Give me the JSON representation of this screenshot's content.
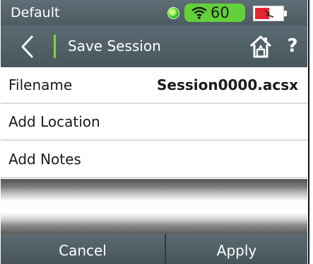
{
  "status_bar": {
    "profile_name": "Default",
    "indicator_color": "#39c51e",
    "wifi_icon": "wifi-icon",
    "wifi_value": "60",
    "battery_icon": "battery-charging-icon",
    "battery_color": "#e4262f"
  },
  "title_bar": {
    "back_icon": "back-chevron-icon",
    "title": "Save Session",
    "home_icon": "home-icon",
    "help_label": "?"
  },
  "rows": {
    "filename": {
      "label": "Filename",
      "value": "Session0000.acsx"
    },
    "location": {
      "label": "Add Location"
    },
    "notes": {
      "label": "Add Notes"
    }
  },
  "buttons": {
    "cancel": "Cancel",
    "apply": "Apply"
  },
  "colors": {
    "accent": "#86d33c",
    "header_bg": "#52616a",
    "wifi_pill": "#63d13a"
  }
}
